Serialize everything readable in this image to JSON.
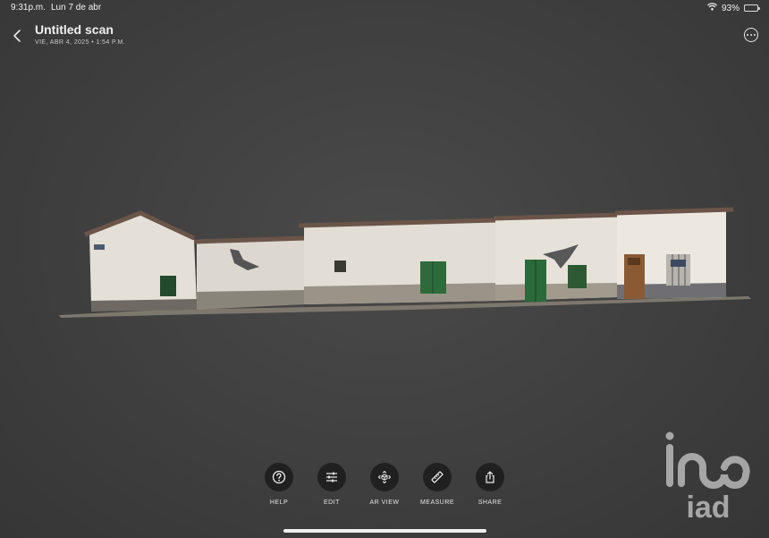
{
  "status_bar": {
    "time": "9:31p.m.",
    "date": "Lun 7 de abr",
    "battery": "93%",
    "battery_level": 0.93,
    "wifi_icon": "wifi-icon"
  },
  "header": {
    "title": "Untitled scan",
    "subtitle": "VIE, ABR 4, 2025  •  1:54 P.M.",
    "back_icon": "chevron-left-icon",
    "more_icon": "ellipsis-circle-icon"
  },
  "toolbar": {
    "items": [
      {
        "label": "HELP",
        "icon": "question-icon"
      },
      {
        "label": "EDIT",
        "icon": "sliders-icon"
      },
      {
        "label": "AR VIEW",
        "icon": "ar-cube-icon"
      },
      {
        "label": "MEASURE",
        "icon": "ruler-icon"
      },
      {
        "label": "SHARE",
        "icon": "share-icon"
      }
    ]
  },
  "watermark": {
    "text": "iad"
  },
  "colors": {
    "background": "#3e3e3e",
    "button_bg": "#202020",
    "door_green": "#2f6b3a",
    "door_wood": "#8a5a34"
  }
}
